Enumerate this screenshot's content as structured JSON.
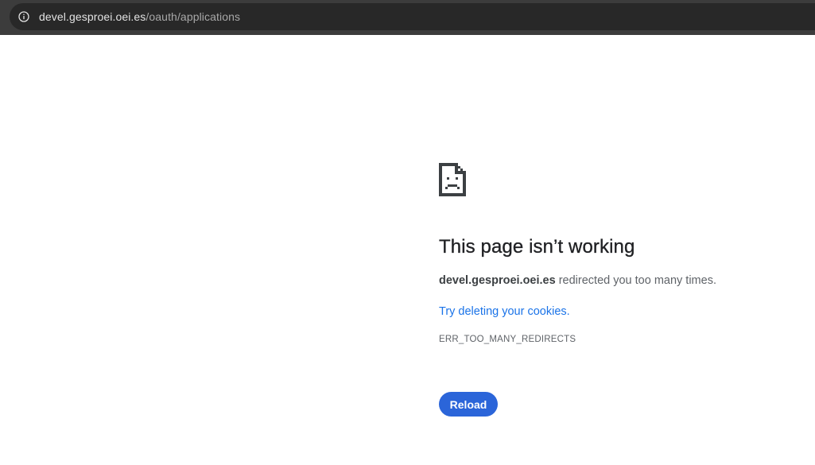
{
  "browser": {
    "url_host": "devel.gesproei.oei.es",
    "url_path": "/oauth/applications",
    "info_icon": "info-icon"
  },
  "error": {
    "icon": "sad-page-icon",
    "title": "This page isn’t working",
    "host": "devel.gesproei.oei.es",
    "message_rest": " redirected you too many times.",
    "suggestion_link": "Try deleting your cookies.",
    "code": "ERR_TOO_MANY_REDIRECTS",
    "reload_label": "Reload"
  },
  "colors": {
    "toolbar": "#3c3c3c",
    "omnibox": "#282828",
    "link": "#1a73e8",
    "button": "#2b65d9"
  }
}
